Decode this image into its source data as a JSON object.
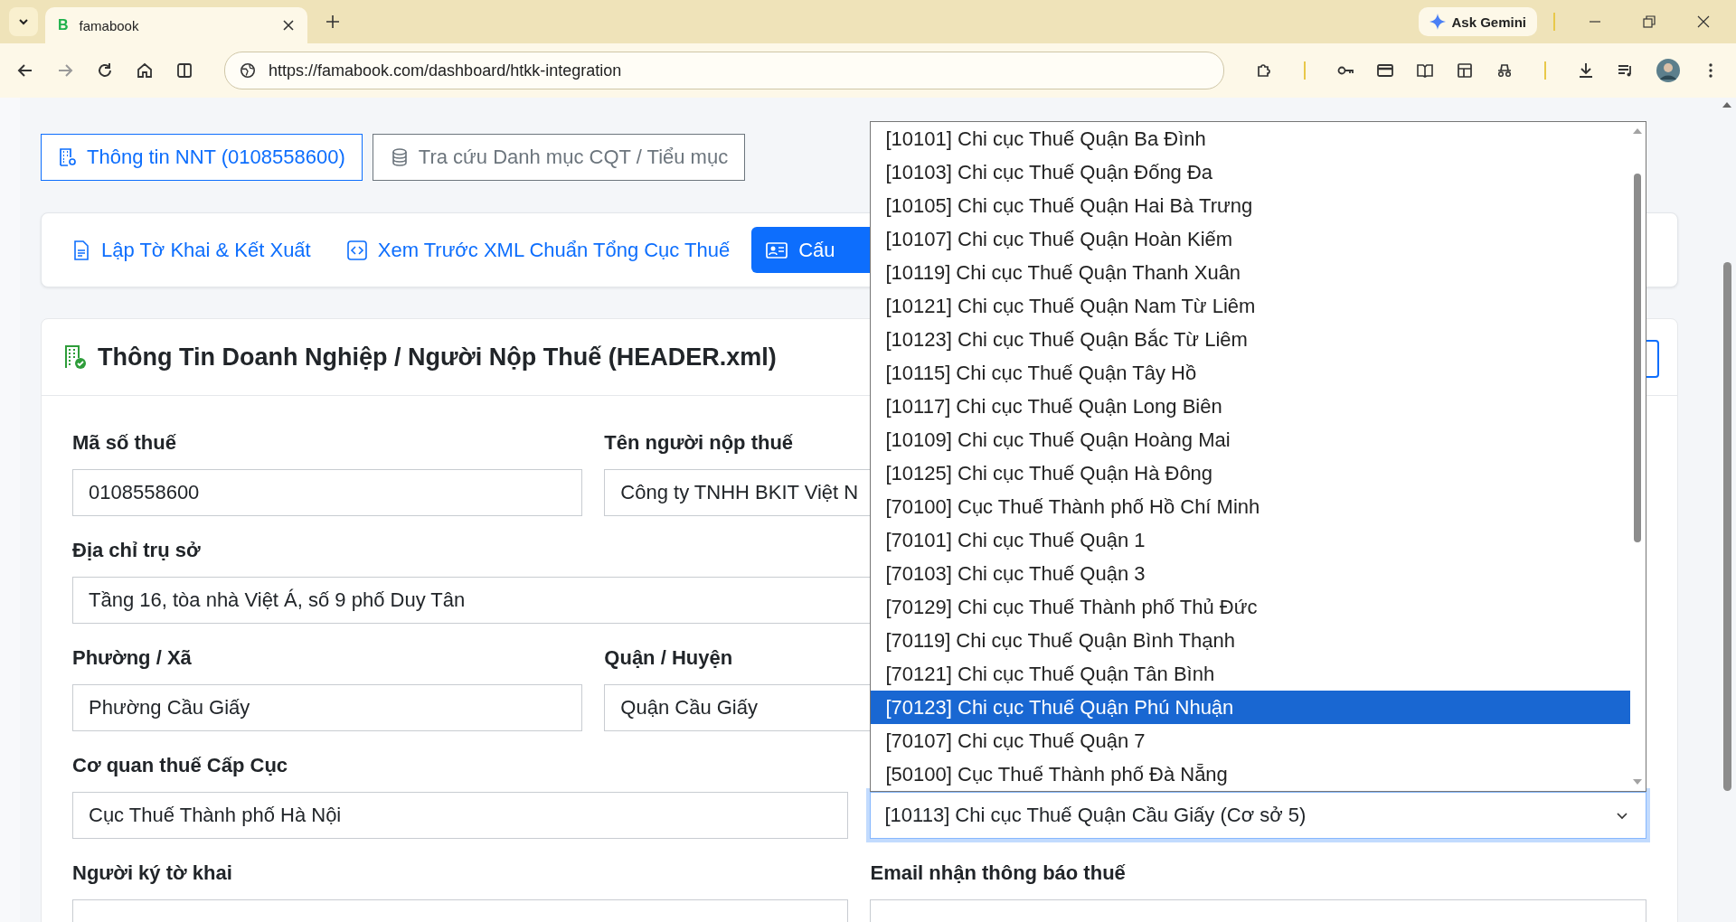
{
  "browser": {
    "tab_title": "famabook",
    "favicon": "B",
    "url": "https://famabook.com/dashboard/htkk-integration",
    "gemini_button": "Ask Gemini"
  },
  "page": {
    "top_buttons": [
      {
        "label": "Thông tin NNT (0108558600)",
        "selected": true,
        "kind": "building"
      },
      {
        "label": "Tra cứu Danh mục CQT / Tiểu mục",
        "selected": false,
        "kind": "database"
      }
    ],
    "nav_tabs": [
      {
        "label": "Lập Tờ Khai & Kết Xuất",
        "selected": false,
        "kind": "document"
      },
      {
        "label": "Xem Trước XML Chuẩn Tổng Cục Thuế",
        "selected": false,
        "kind": "code"
      },
      {
        "label": "Cấu",
        "selected": true,
        "kind": "card"
      }
    ],
    "section_title": "Thông Tin Doanh Nghiệp / Người Nộp Thuế (HEADER.xml)",
    "form_rows": [
      {
        "kind": "thirds",
        "fields": [
          {
            "label": "Mã số thuế",
            "kind": "input",
            "value": "0108558600"
          },
          {
            "label": "Tên người nộp thuế",
            "kind": "input",
            "value": "Công ty TNHH BKIT Việt N"
          }
        ]
      },
      {
        "kind": "full",
        "fields": [
          {
            "label": "Địa chỉ trụ sở",
            "kind": "input",
            "value": "Tầng 16, tòa nhà Việt Á, số 9 phố Duy Tân"
          }
        ]
      },
      {
        "kind": "thirds",
        "fields": [
          {
            "label": "Phường / Xã",
            "kind": "input",
            "value": "Phường Cầu Giấy"
          },
          {
            "label": "Quận / Huyện",
            "kind": "input",
            "value": "Quận Cầu Giấy"
          }
        ]
      },
      {
        "kind": "halves",
        "fields": [
          {
            "label": "Cơ quan thuế Cấp Cục",
            "kind": "input",
            "value": "Cục Thuế Thành phố Hà Nội"
          },
          {
            "kind": "select",
            "value": "[10113] Chi cục Thuế Quận Cầu Giấy (Cơ sở 5)",
            "expanded": true,
            "options": [
              {
                "label": "[10101] Chi cục Thuế Quận Ba Đình",
                "selected": false
              },
              {
                "label": "[10103] Chi cục Thuế Quận Đống Đa",
                "selected": false
              },
              {
                "label": "[10105] Chi cục Thuế Quận Hai Bà Trưng",
                "selected": false
              },
              {
                "label": "[10107] Chi cục Thuế Quận Hoàn Kiếm",
                "selected": false
              },
              {
                "label": "[10119] Chi cục Thuế Quận Thanh Xuân",
                "selected": false
              },
              {
                "label": "[10121] Chi cục Thuế Quận Nam Từ Liêm",
                "selected": false
              },
              {
                "label": "[10123] Chi cục Thuế Quận Bắc Từ Liêm",
                "selected": false
              },
              {
                "label": "[10115] Chi cục Thuế Quận Tây Hồ",
                "selected": false
              },
              {
                "label": "[10117] Chi cục Thuế Quận Long Biên",
                "selected": false
              },
              {
                "label": "[10109] Chi cục Thuế Quận Hoàng Mai",
                "selected": false
              },
              {
                "label": "[10125] Chi cục Thuế Quận Hà Đông",
                "selected": false
              },
              {
                "label": "[70100] Cục Thuế Thành phố Hồ Chí Minh",
                "selected": false
              },
              {
                "label": "[70101] Chi cục Thuế Quận 1",
                "selected": false
              },
              {
                "label": "[70103] Chi cục Thuế Quận 3",
                "selected": false
              },
              {
                "label": "[70129] Chi cục Thuế Thành phố Thủ Đức",
                "selected": false
              },
              {
                "label": "[70119] Chi cục Thuế Quận Bình Thạnh",
                "selected": false
              },
              {
                "label": "[70121] Chi cục Thuế Quận Tân Bình",
                "selected": false
              },
              {
                "label": "[70123] Chi cục Thuế Quận Phú Nhuận",
                "selected": true
              },
              {
                "label": "[70107] Chi cục Thuế Quận 7",
                "selected": false
              },
              {
                "label": "[50100] Cục Thuế Thành phố Đà Nẵng",
                "selected": false
              }
            ]
          }
        ]
      },
      {
        "kind": "halves",
        "fields": [
          {
            "label": "Người ký tờ khai",
            "kind": "input"
          },
          {
            "label": "Email nhận thông báo thuế",
            "kind": "input"
          }
        ]
      }
    ]
  }
}
